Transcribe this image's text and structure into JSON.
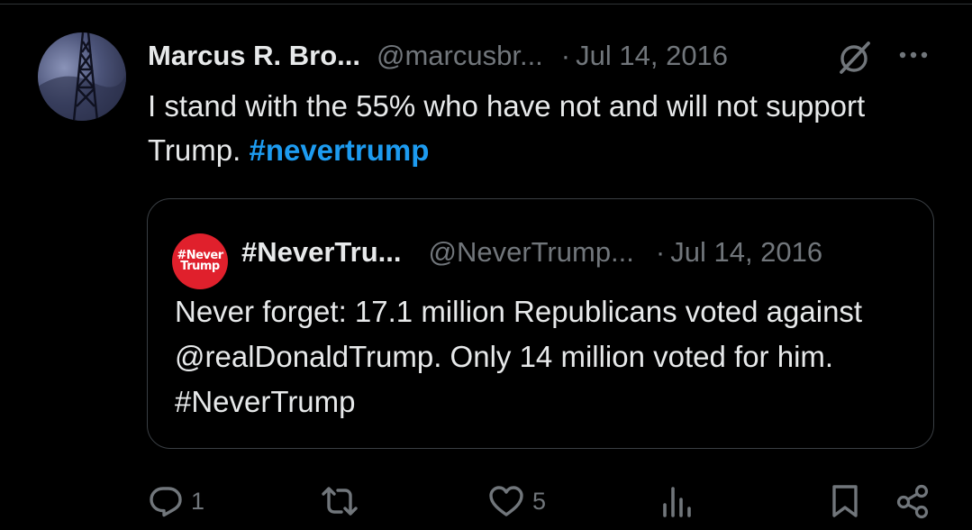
{
  "tweet": {
    "author_name": "Marcus R. Bro...",
    "author_handle": "@marcusbr...",
    "separator": "·",
    "date": "Jul 14, 2016",
    "text_before_hashtag": "I stand with the 55% who have not and will not support Trump. ",
    "hashtag": "#nevertrump"
  },
  "quote": {
    "avatar_text_line1": "#Never",
    "avatar_text_line2": "Trump",
    "author_name": "#NeverTru...",
    "author_handle": "@NeverTrump...",
    "separator": "·",
    "date": "Jul 14, 2016",
    "text": "Never forget: 17.1 million Republicans voted against @realDonaldTrump. Only 14 million voted for him. #NeverTrump"
  },
  "actions": {
    "reply_count": "1",
    "retweet_count": "",
    "like_count": "5",
    "views_count": ""
  },
  "icons": {
    "grok": "grok-icon",
    "more": "more-icon",
    "reply": "reply-icon",
    "retweet": "retweet-icon",
    "like": "heart-icon",
    "views": "views-icon",
    "bookmark": "bookmark-icon",
    "share": "share-icon"
  },
  "colors": {
    "background": "#000000",
    "text": "#e7e9ea",
    "muted": "#71767b",
    "link": "#1d9bf0",
    "border": "#3a3f44",
    "quote_avatar": "#e0202c"
  }
}
